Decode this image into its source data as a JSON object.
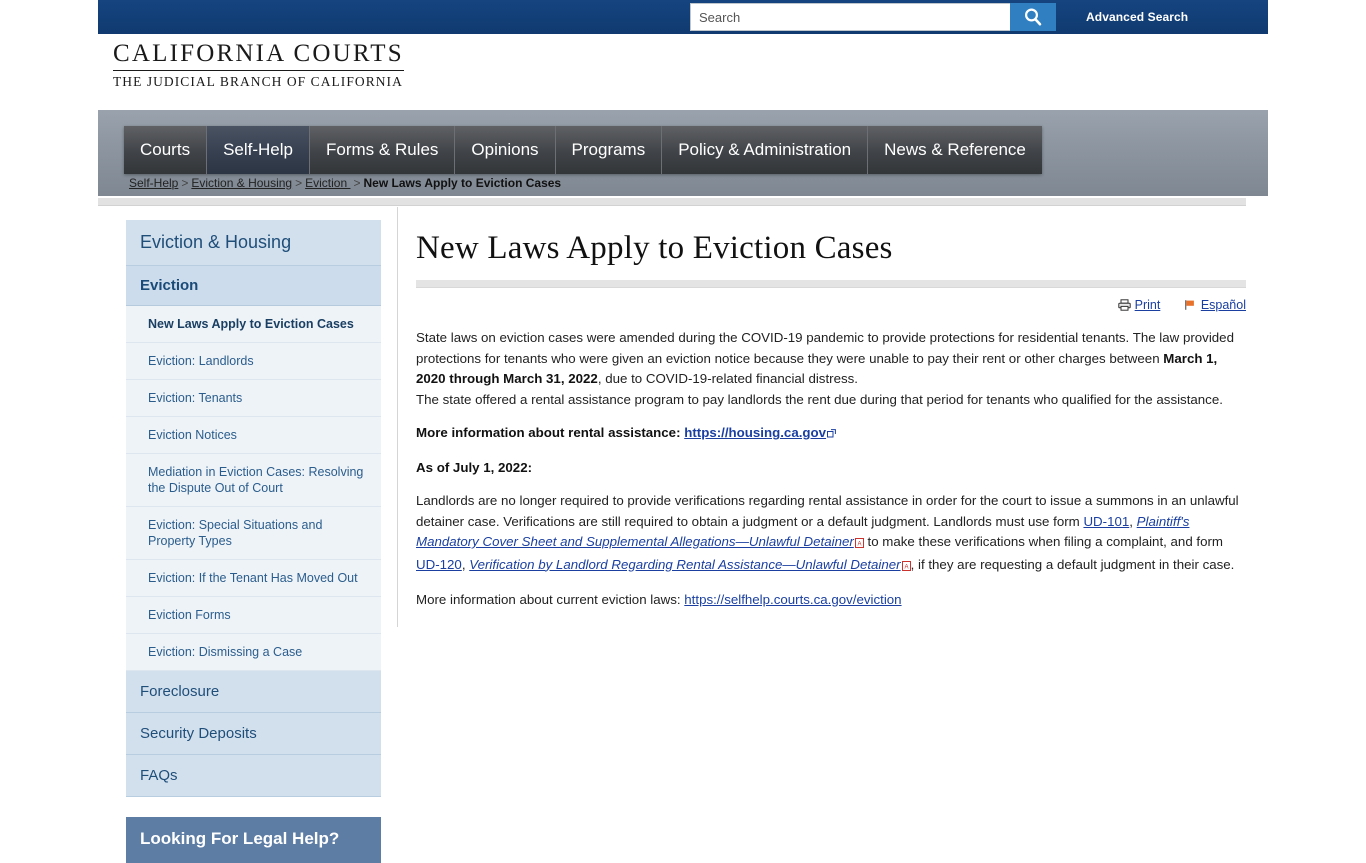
{
  "colors": {
    "topbar_blue": "#12407c",
    "search_button_blue": "#2f7fc1",
    "nav_gray": "#404347",
    "nav_active": "#364050",
    "sidebar_blue": "#d2e0ee",
    "sidebar_sub": "#eef3f8",
    "link_blue": "#1a3fa0",
    "promo_blue": "#5d7da5",
    "flag_orange": "#e8722b"
  },
  "topbar": {
    "search_placeholder": "Search",
    "search_value": "",
    "search_button_icon": "search-icon",
    "advanced_search_label": "Advanced Search"
  },
  "logo": {
    "main": "CALIFORNIA COURTS",
    "sub": "THE JUDICIAL BRANCH OF CALIFORNIA"
  },
  "nav": {
    "items": [
      {
        "label": "Courts",
        "active": false
      },
      {
        "label": "Self-Help",
        "active": true
      },
      {
        "label": "Forms & Rules",
        "active": false
      },
      {
        "label": "Opinions",
        "active": false
      },
      {
        "label": "Programs",
        "active": false
      },
      {
        "label": "Policy & Administration",
        "active": false
      },
      {
        "label": "News & Reference",
        "active": false
      }
    ]
  },
  "breadcrumb": {
    "items": [
      {
        "label": "Self-Help",
        "link": true
      },
      {
        "label": "Eviction & Housing",
        "link": true
      },
      {
        "label": "Eviction ",
        "link": true
      },
      {
        "label": "New Laws Apply to Eviction Cases",
        "link": false
      }
    ],
    "separator": ">"
  },
  "sidebar": {
    "heading": "Eviction & Housing",
    "section": "Eviction",
    "sub_items": [
      {
        "label": "New Laws Apply to Eviction Cases",
        "active": true
      },
      {
        "label": "Eviction: Landlords",
        "active": false
      },
      {
        "label": "Eviction: Tenants",
        "active": false
      },
      {
        "label": "Eviction Notices",
        "active": false
      },
      {
        "label": "Mediation in Eviction Cases: Resolving the Dispute Out of Court",
        "active": false
      },
      {
        "label": "Eviction: Special Situations and Property Types",
        "active": false
      },
      {
        "label": "Eviction: If the Tenant Has Moved Out",
        "active": false
      },
      {
        "label": "Eviction Forms",
        "active": false
      },
      {
        "label": "Eviction: Dismissing a Case",
        "active": false
      }
    ],
    "major_items": [
      {
        "label": "Foreclosure"
      },
      {
        "label": "Security Deposits"
      },
      {
        "label": "FAQs"
      }
    ],
    "promo_title": "Looking For Legal Help?"
  },
  "main": {
    "title": "New Laws Apply to Eviction Cases",
    "utilities": [
      {
        "label": "Print",
        "icon": "printer-icon"
      },
      {
        "label": "Español",
        "icon": "flag-icon"
      }
    ],
    "paragraph_1_a": "State laws on eviction cases were amended during the COVID-19 pandemic to provide protections for residential tenants. The law provided protections for tenants who were given an eviction notice because they were unable to pay their rent or other charges between ",
    "paragraph_1_bold": "March 1, 2020 through March 31, 2022",
    "paragraph_1_b": ", due to COVID-19-related financial distress.",
    "paragraph_2": "The state offered a rental assistance program to pay landlords the rent due during that period for tenants who qualified for the assistance.",
    "rental_assistance_label": "More information about rental assistance: ",
    "rental_assistance_link": "https://housing.ca.gov",
    "as_of_heading": "As of July 1, 2022:",
    "paragraph_3_a": "Landlords are no longer required to provide verifications regarding rental assistance in order for the court to issue a summons in an unlawful detainer case. Verifications are still required to obtain a judgment or a default judgment. Landlords must use form ",
    "ud101_code": "UD-101",
    "ud101_title": "Plaintiff's Mandatory Cover Sheet and Supplemental Allegations—Unlawful Detainer",
    "paragraph_3_b": " to make these verifications when filing a complaint, and form ",
    "ud120_code": "UD-120",
    "ud120_title": "Verification by Landlord Regarding Rental Assistance—Unlawful Detainer",
    "paragraph_3_c": ", if they are requesting a default judgment in their case.",
    "eviction_laws_label": "More information about current eviction laws: ",
    "eviction_laws_link": "https://selfhelp.courts.ca.gov/eviction"
  }
}
